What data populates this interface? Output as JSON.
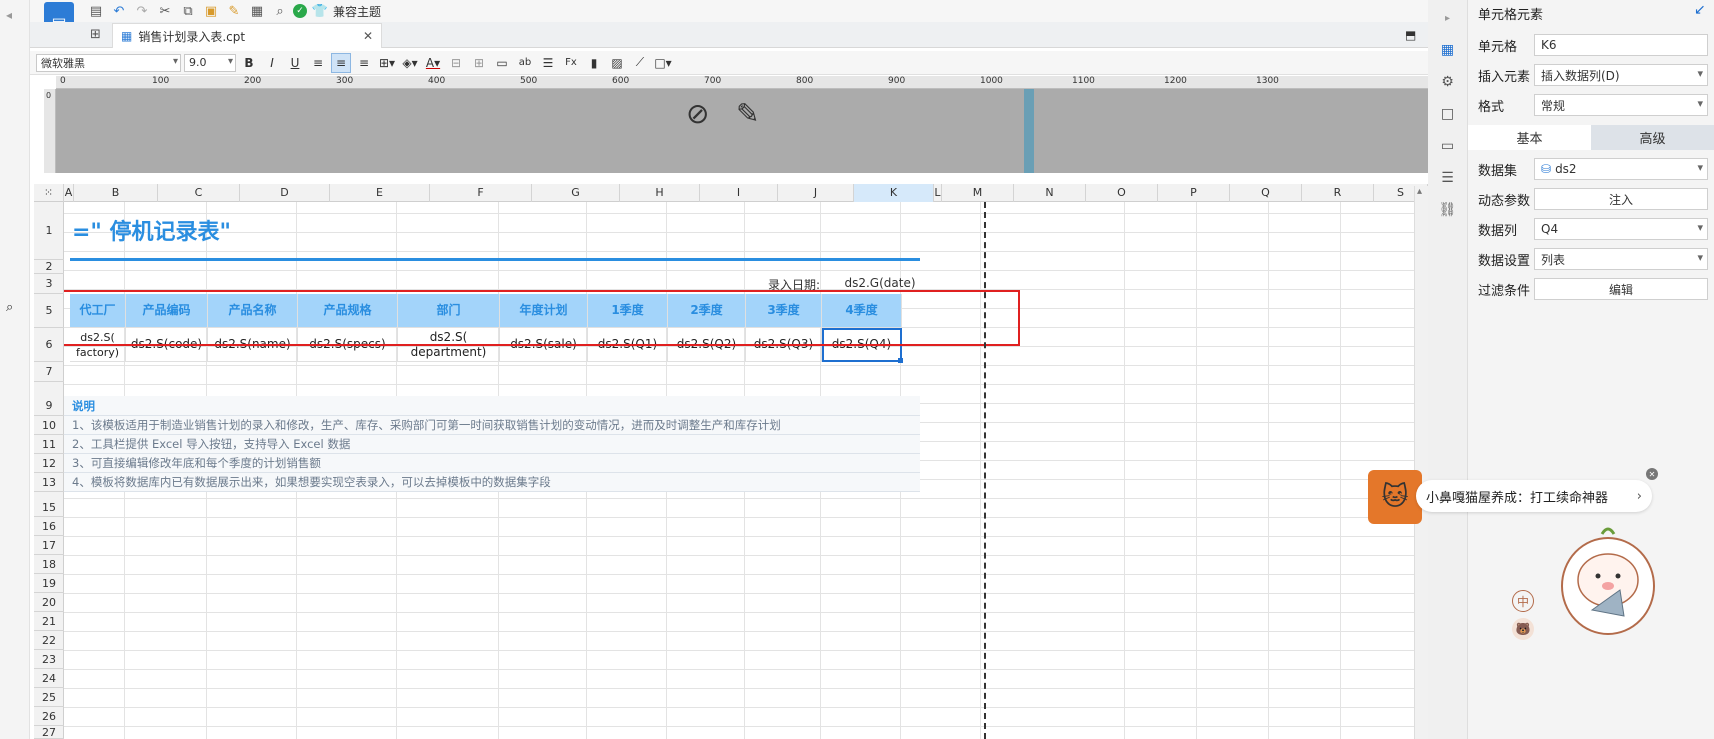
{
  "toolbar": {
    "compat_label": "兼容主题"
  },
  "tab": {
    "title": "销售计划录入表.cpt"
  },
  "format": {
    "font": "微软雅黑",
    "size": "9.0"
  },
  "ruler": {
    "ticks": [
      "0",
      "100",
      "200",
      "300",
      "400",
      "500",
      "600",
      "700",
      "800",
      "900",
      "1000",
      "1100",
      "1200",
      "1300"
    ]
  },
  "columns": [
    "A",
    "B",
    "C",
    "D",
    "E",
    "F",
    "G",
    "H",
    "I",
    "J",
    "K",
    "L",
    "M",
    "N",
    "O",
    "P",
    "Q",
    "R",
    "S"
  ],
  "rows": [
    "1",
    "2",
    "3",
    "5",
    "6",
    "7",
    "9",
    "10",
    "11",
    "12",
    "13",
    "15",
    "16",
    "17",
    "18",
    "19",
    "20",
    "21",
    "22",
    "23",
    "24",
    "25",
    "26",
    "27"
  ],
  "report": {
    "title": "=\"  停机记录表\"",
    "date_label": "录入日期:",
    "date_value": "ds2.G(date)",
    "headers": [
      "代工厂",
      "产品编码",
      "产品名称",
      "产品规格",
      "部门",
      "年度计划",
      "1季度",
      "2季度",
      "3季度",
      "4季度"
    ],
    "cells": [
      "ds2.S(\nfactory)",
      "ds2.S(code)",
      "ds2.S(name)",
      "ds2.S(specs)",
      "ds2.S(\ndepartment)",
      "ds2.S(sale)",
      "ds2.S(Q1)",
      "ds2.S(Q2)",
      "ds2.S(Q3)",
      "ds2.S(Q4)"
    ],
    "notes_title": "说明",
    "notes": [
      "1、该模板适用于制造业销售计划的录入和修改，生产、库存、采购部门可第一时间获取销售计划的变动情况，进而及时调整生产和库存计划",
      "2、工具栏提供 Excel 导入按钮，支持导入 Excel 数据",
      "3、可直接编辑修改年底和每个季度的计划销售额",
      "4、模板将数据库内已有数据展示出来，如果想要实现空表录入，可以去掉模板中的数据集字段"
    ]
  },
  "panel": {
    "title": "单元格元素",
    "cell_label": "单元格",
    "cell_value": "K6",
    "insert_label": "插入元素",
    "insert_value": "插入数据列(D)",
    "format_label": "格式",
    "format_value": "常规",
    "tab_basic": "基本",
    "tab_adv": "高级",
    "dataset_label": "数据集",
    "dataset_value": "ds2",
    "param_label": "动态参数",
    "param_btn": "注入",
    "column_label": "数据列",
    "column_value": "Q4",
    "setting_label": "数据设置",
    "setting_value": "列表",
    "filter_label": "过滤条件",
    "filter_btn": "编辑"
  },
  "ad": {
    "text": "小鼻嘎猫屋养成：打工续命神器",
    "zh": "中"
  }
}
